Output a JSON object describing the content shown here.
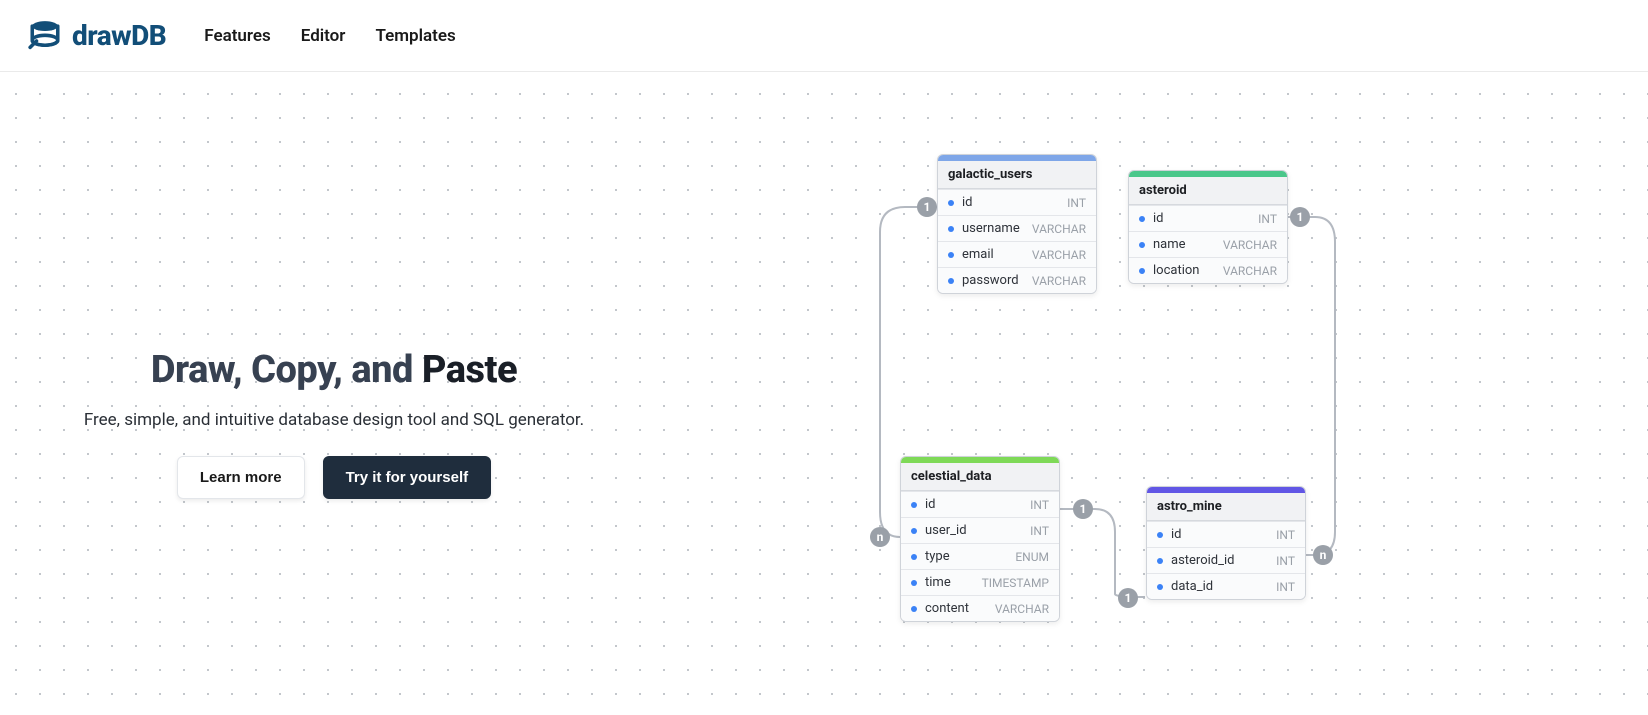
{
  "brand": {
    "name": "drawDB"
  },
  "nav": {
    "features": "Features",
    "editor": "Editor",
    "templates": "Templates"
  },
  "hero": {
    "title_plain": "Draw, Copy, and ",
    "title_emph": "Paste",
    "subtitle": "Free, simple, and intuitive database design tool and SQL generator.",
    "learn_more": "Learn more",
    "try_it": "Try it for yourself"
  },
  "colors": {
    "stripe_blue": "#7ea6e8",
    "stripe_green": "#4ac78a",
    "stripe_light_green": "#7ed957",
    "stripe_indigo": "#6156e5"
  },
  "tables": {
    "galactic_users": {
      "title": "galactic_users",
      "fields": [
        {
          "name": "id",
          "type": "INT"
        },
        {
          "name": "username",
          "type": "VARCHAR"
        },
        {
          "name": "email",
          "type": "VARCHAR"
        },
        {
          "name": "password",
          "type": "VARCHAR"
        }
      ]
    },
    "asteroid": {
      "title": "asteroid",
      "fields": [
        {
          "name": "id",
          "type": "INT"
        },
        {
          "name": "name",
          "type": "VARCHAR"
        },
        {
          "name": "location",
          "type": "VARCHAR"
        }
      ]
    },
    "celestial_data": {
      "title": "celestial_data",
      "fields": [
        {
          "name": "id",
          "type": "INT"
        },
        {
          "name": "user_id",
          "type": "INT"
        },
        {
          "name": "type",
          "type": "ENUM"
        },
        {
          "name": "time",
          "type": "TIMESTAMP"
        },
        {
          "name": "content",
          "type": "VARCHAR"
        }
      ]
    },
    "astro_mine": {
      "title": "astro_mine",
      "fields": [
        {
          "name": "id",
          "type": "INT"
        },
        {
          "name": "asteroid_id",
          "type": "INT"
        },
        {
          "name": "data_id",
          "type": "INT"
        }
      ]
    }
  },
  "conn_labels": {
    "one": "1",
    "many": "n"
  }
}
